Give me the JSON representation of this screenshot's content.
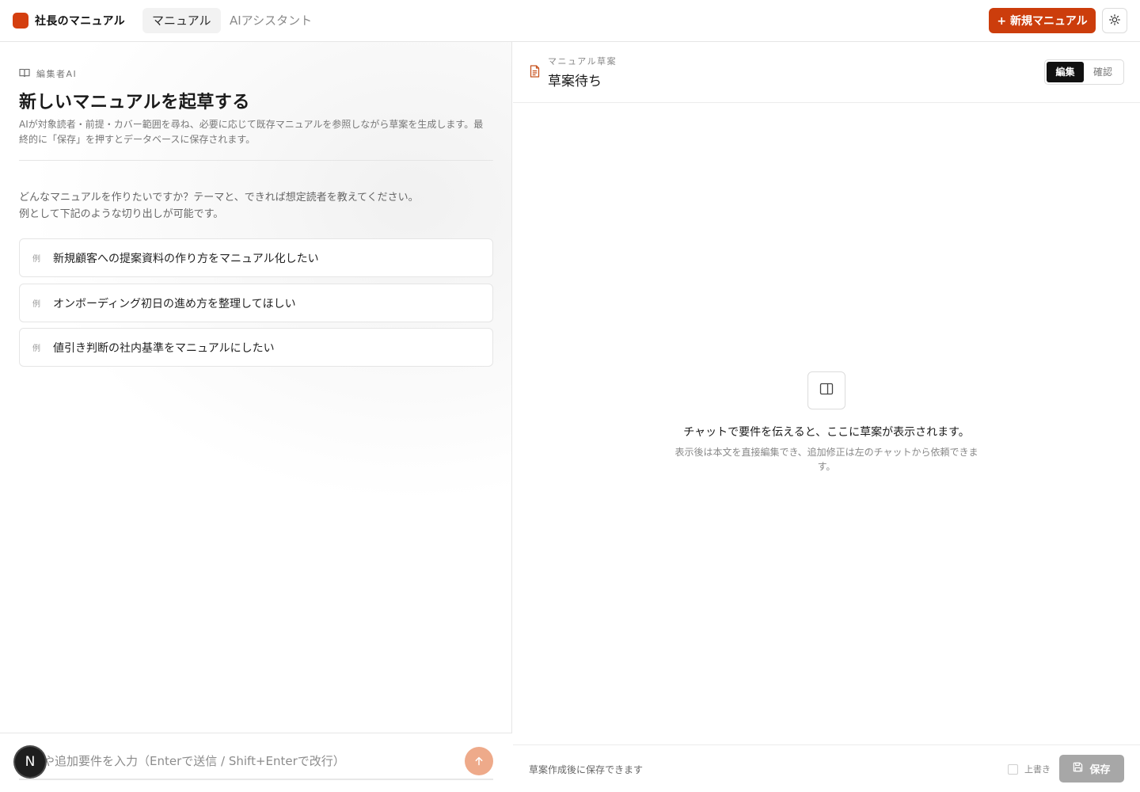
{
  "header": {
    "app_name": "社長のマニュアル",
    "brand_color": "#d43f0f",
    "nav": [
      {
        "label": "マニュアル",
        "active": true
      },
      {
        "label": "AIアシスタント",
        "active": false
      }
    ],
    "new_manual_label": "+ 新規マニュアル",
    "theme_icon": "sun-icon"
  },
  "left": {
    "editor_label": "編集者AI",
    "title": "新しいマニュアルを起草する",
    "description": "AIが対象読者・前提・カバー範囲を尋ね、必要に応じて既存マニュアルを参照しながら草案を生成します。最終的に「保存」を押すとデータベースに保存されます。",
    "prompt_line1": "どんなマニュアルを作りたいですか？テーマと、できれば想定読者を教えてください。",
    "prompt_line2": "例として下記のような切り出しが可能です。",
    "examples": [
      {
        "tag": "例",
        "text": "新規顧客への提案資料の作り方をマニュアル化したい"
      },
      {
        "tag": "例",
        "text": "オンボーディング初日の進め方を整理してほしい"
      },
      {
        "tag": "例",
        "text": "値引き判断の社内基準をマニュアルにしたい"
      }
    ],
    "input_placeholder": "返信や追加要件を入力（Enterで送信 / Shift+Enterで改行）",
    "avatar_letter": "N"
  },
  "right": {
    "draft_label": "マニュアル草案",
    "draft_status": "草案待ち",
    "modes": {
      "edit": "編集",
      "review": "確認",
      "active": "edit"
    },
    "empty_title": "チャットで要件を伝えると、ここに草案が表示されます。",
    "empty_desc": "表示後は本文を直接編集でき、追加修正は左のチャットから依頼できます。",
    "footer_note": "草案作成後に保存できます",
    "overwrite_label": "上書き",
    "overwrite_checked": false,
    "save_label": "保存"
  }
}
